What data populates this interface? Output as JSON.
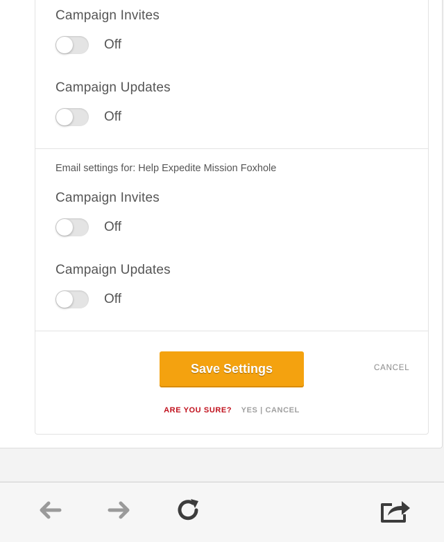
{
  "sections": [
    {
      "heading": "",
      "settings": [
        {
          "label": "Campaign Invites",
          "state": "Off",
          "enabled": false
        },
        {
          "label": "Campaign Updates",
          "state": "Off",
          "enabled": false
        }
      ]
    },
    {
      "heading": "Email settings for: Help Expedite Mission Foxhole",
      "settings": [
        {
          "label": "Campaign Invites",
          "state": "Off",
          "enabled": false
        },
        {
          "label": "Campaign Updates",
          "state": "Off",
          "enabled": false
        }
      ]
    }
  ],
  "actions": {
    "save_label": "Save Settings",
    "cancel_label": "CANCEL",
    "confirm_prompt": "ARE YOU SURE?",
    "confirm_yes": "YES",
    "confirm_separator": "|",
    "confirm_cancel": "CANCEL"
  },
  "toolbar": {
    "icons": [
      "back-arrow-icon",
      "forward-arrow-icon",
      "reload-icon",
      "share-icon"
    ]
  },
  "colors": {
    "accent": "#f4a20f",
    "warning": "#c0101c",
    "muted": "#a0a0a0"
  }
}
